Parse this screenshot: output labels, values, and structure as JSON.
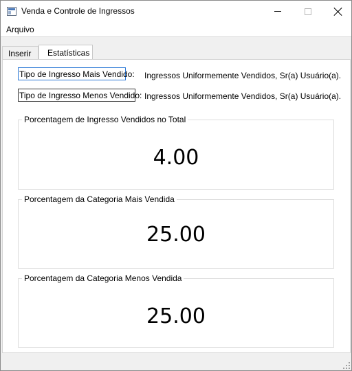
{
  "window": {
    "title": "Venda e Controle de Ingressos"
  },
  "menu": {
    "items": [
      "Arquivo"
    ]
  },
  "tabs": [
    {
      "label": "Inserir",
      "active": false
    },
    {
      "label": "Estatísticas",
      "active": true
    }
  ],
  "stats": {
    "most_sold_label": "Tipo de Ingresso Mais Vendido:",
    "most_sold_value": "Ingressos Uniformemente Vendidos, Sr(a) Usuário(a).",
    "least_sold_label": "Tipo de Ingresso Menos Vendido:",
    "least_sold_value": "Ingressos Uniformemente Vendidos, Sr(a) Usuário(a).",
    "groups": [
      {
        "title": "Porcentagem de Ingresso Vendidos no Total",
        "value": "4.00"
      },
      {
        "title": "Porcentagem da Categoria Mais Vendida",
        "value": "25.00"
      },
      {
        "title": "Porcentagem da Categoria Menos Vendida",
        "value": "25.00"
      }
    ]
  },
  "colors": {
    "focus_border": "#2a78d6",
    "panel_background": "#ffffff",
    "window_background": "#f0f0f0"
  },
  "icons": {
    "app": "app-window-icon",
    "minimize": "minimize-icon",
    "maximize": "maximize-icon",
    "close": "close-icon",
    "grip": "resize-grip-icon"
  }
}
